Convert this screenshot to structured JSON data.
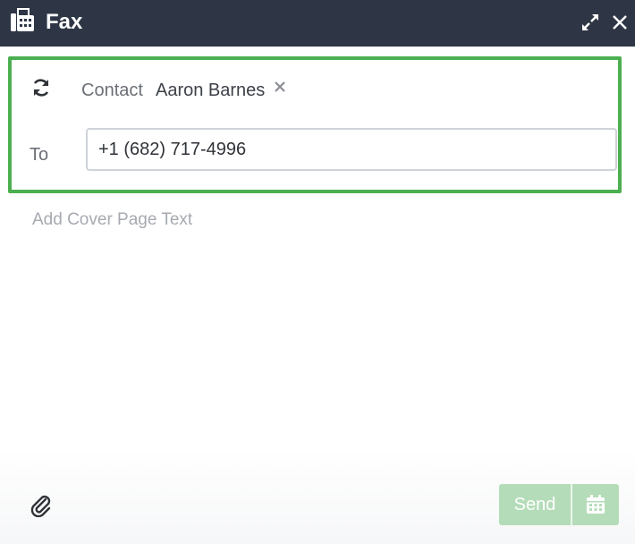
{
  "window": {
    "title": "Fax",
    "title_icon": "fax-icon",
    "expand_icon": "expand-icon",
    "close_icon": "close-icon"
  },
  "recipient": {
    "refresh_icon": "refresh-icon",
    "contact_label": "Contact",
    "contact_name": "Aaron Barnes",
    "remove_icon": "remove-contact-icon",
    "to_label": "To",
    "to_value": "+1 (682) 717-4996"
  },
  "body": {
    "cover_placeholder": "Add Cover Page Text"
  },
  "footer": {
    "attach_icon": "paperclip-icon",
    "send_label": "Send",
    "schedule_icon": "calendar-icon"
  },
  "colors": {
    "titlebar": "#2e3646",
    "highlight_border": "#4caf50",
    "send_button_disabled": "#b5dcb9"
  }
}
